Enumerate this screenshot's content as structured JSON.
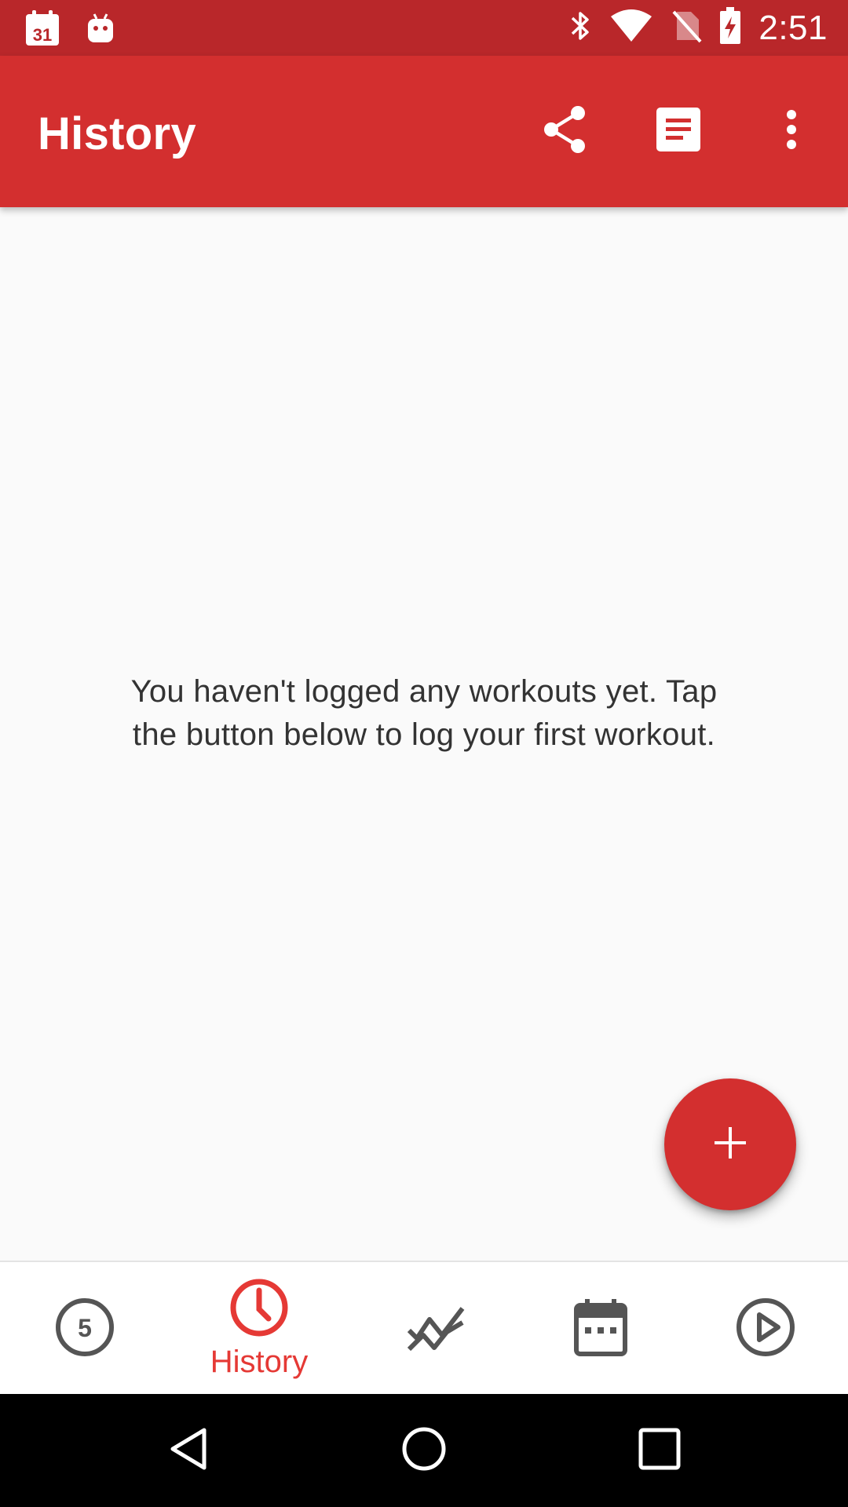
{
  "status_bar": {
    "time": "2:51",
    "calendar_day": "31",
    "icons": [
      "calendar-icon",
      "android-icon",
      "bluetooth-icon",
      "wifi-icon",
      "no-sim-icon",
      "battery-charging-icon"
    ]
  },
  "app_bar": {
    "title": "History",
    "actions": [
      "share-icon",
      "notes-icon",
      "more-vert-icon"
    ]
  },
  "main": {
    "empty_message": "You haven't logged any workouts yet. Tap the button below to log your first workout."
  },
  "fab": {
    "icon": "plus-icon"
  },
  "bottom_nav": {
    "items": [
      {
        "icon": "five-circle-icon",
        "badge": "5",
        "label": ""
      },
      {
        "icon": "clock-icon",
        "label": "History",
        "active": true
      },
      {
        "icon": "trend-chart-icon",
        "label": ""
      },
      {
        "icon": "calendar-icon",
        "label": ""
      },
      {
        "icon": "play-circle-icon",
        "label": ""
      }
    ]
  },
  "system_nav": {
    "buttons": [
      "back-icon",
      "home-icon",
      "recents-icon"
    ]
  },
  "colors": {
    "primary": "#d32f2f",
    "primary_dark": "#b9272a",
    "accent": "#e53935",
    "icon_inactive": "#555555"
  }
}
